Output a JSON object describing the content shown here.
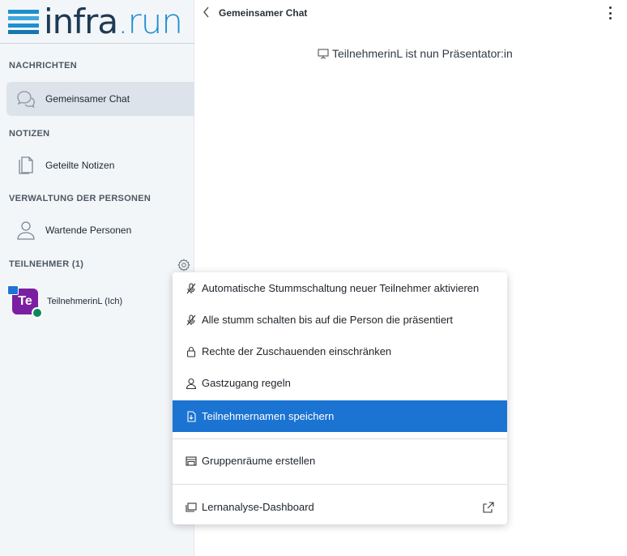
{
  "logo": {
    "main": "infra",
    "dot": ".",
    "tld": "run"
  },
  "sidebar": {
    "messages_title": "NACHRICHTEN",
    "public_chat": "Gemeinsamer Chat",
    "notes_title": "NOTIZEN",
    "shared_notes": "Geteilte Notizen",
    "user_management_title": "VERWALTUNG DER PERSONEN",
    "waiting_users": "Wartende Personen",
    "participants_title": "TEILNEHMER (1)",
    "participant": {
      "initials": "Te",
      "name": "TeilnehmerinL (Ich)"
    }
  },
  "chat": {
    "title": "Gemeinsamer Chat",
    "system_message": "TeilnehmerinL ist nun Präsentator:in"
  },
  "menu": {
    "items": [
      {
        "label": "Automatische Stummschaltung neuer Teilnehmer aktivieren",
        "icon": "mic-off-icon"
      },
      {
        "label": "Alle stumm schalten bis auf die Person die präsentiert",
        "icon": "mic-off-icon"
      },
      {
        "label": "Rechte der Zuschauenden einschränken",
        "icon": "lock-icon"
      },
      {
        "label": "Gastzugang regeln",
        "icon": "user-icon"
      },
      {
        "label": "Teilnehmernamen speichern",
        "icon": "download-file-icon",
        "selected": true
      },
      {
        "label": "Gruppenräume erstellen",
        "icon": "rooms-icon"
      },
      {
        "label": "Lernanalyse-Dashboard",
        "icon": "dashboard-icon"
      }
    ]
  },
  "colors": {
    "accent": "#1b73d2",
    "avatar": "#7b1fa2",
    "mic_badge": "#0a8a5c",
    "logo_blue": "#1f8fd0",
    "logo_dark": "#1e3a54"
  }
}
